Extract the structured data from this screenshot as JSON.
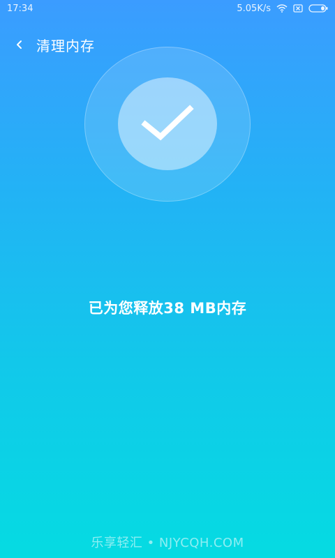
{
  "status_bar": {
    "time": "17:34",
    "network_speed": "5.05K/s"
  },
  "header": {
    "title": "清理内存"
  },
  "result": {
    "message": "已为您释放38 MB内存"
  },
  "watermark": {
    "text": "乐享轻汇 • NJYCQH.COM"
  },
  "colors": {
    "gradient_top": "#3b9cff",
    "gradient_bottom": "#05dbe2",
    "text": "#ffffff"
  },
  "icons": {
    "back": "chevron-left-icon",
    "check": "checkmark-icon",
    "wifi": "wifi-icon",
    "sim": "no-sim-icon",
    "battery": "battery-icon"
  }
}
